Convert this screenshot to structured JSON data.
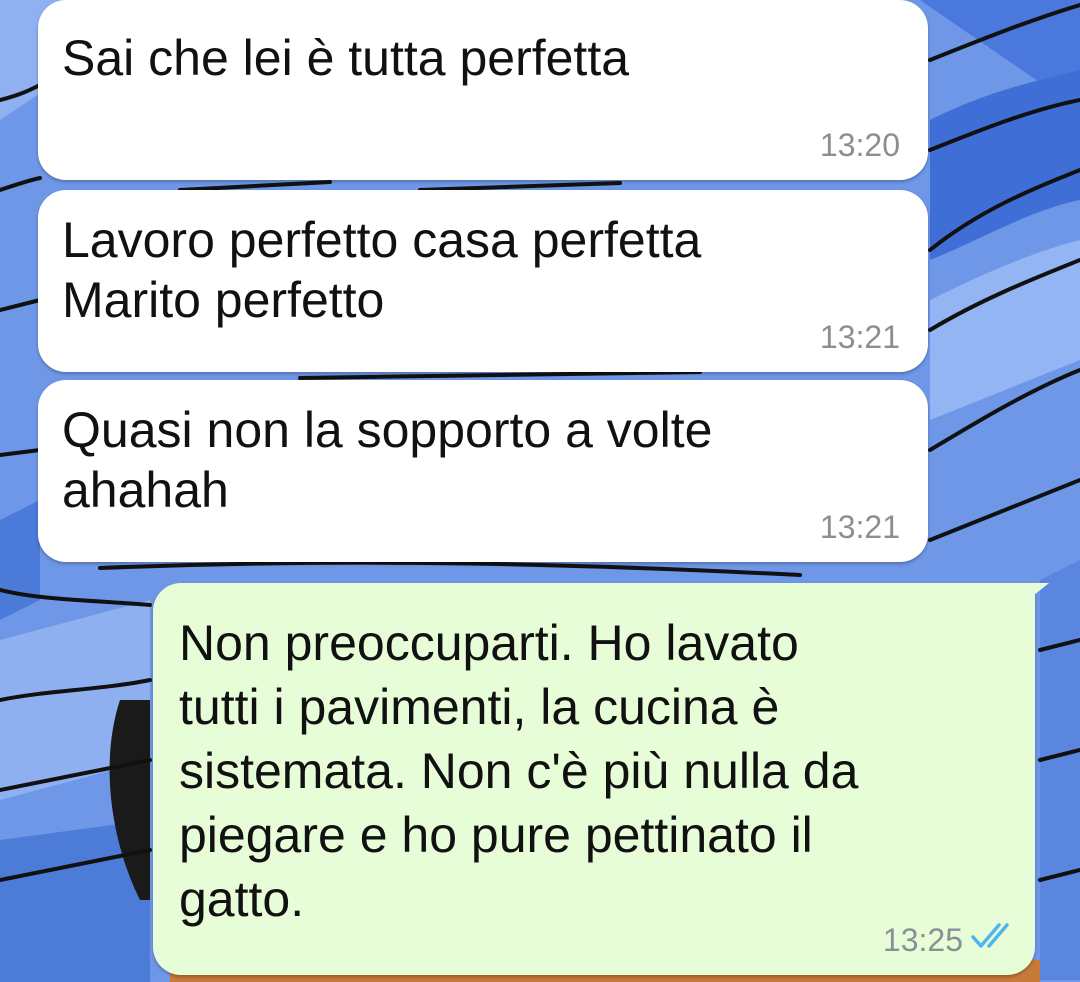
{
  "chat": {
    "messages": [
      {
        "direction": "incoming",
        "text": "Sai che lei è tutta perfetta",
        "time": "13:20"
      },
      {
        "direction": "incoming",
        "text": "Lavoro perfetto casa perfetta\nMarito perfetto",
        "time": "13:21"
      },
      {
        "direction": "incoming",
        "text": "Quasi non la sopporto a volte\nahahah",
        "time": "13:21"
      },
      {
        "direction": "outgoing",
        "text": "Non preoccuparti. Ho lavato\ntutti i pavimenti, la cucina è\nsistemata. Non c'è più nulla da\npiegare e ho pure pettinato il\ngatto.",
        "time": "13:25",
        "status": "read",
        "status_icon": "double-check-icon"
      }
    ]
  },
  "colors": {
    "incoming_bubble": "#ffffff",
    "outgoing_bubble": "#e7fdd8",
    "wallpaper_primary": "#6f97e8",
    "read_ticks": "#4fb6ec"
  }
}
